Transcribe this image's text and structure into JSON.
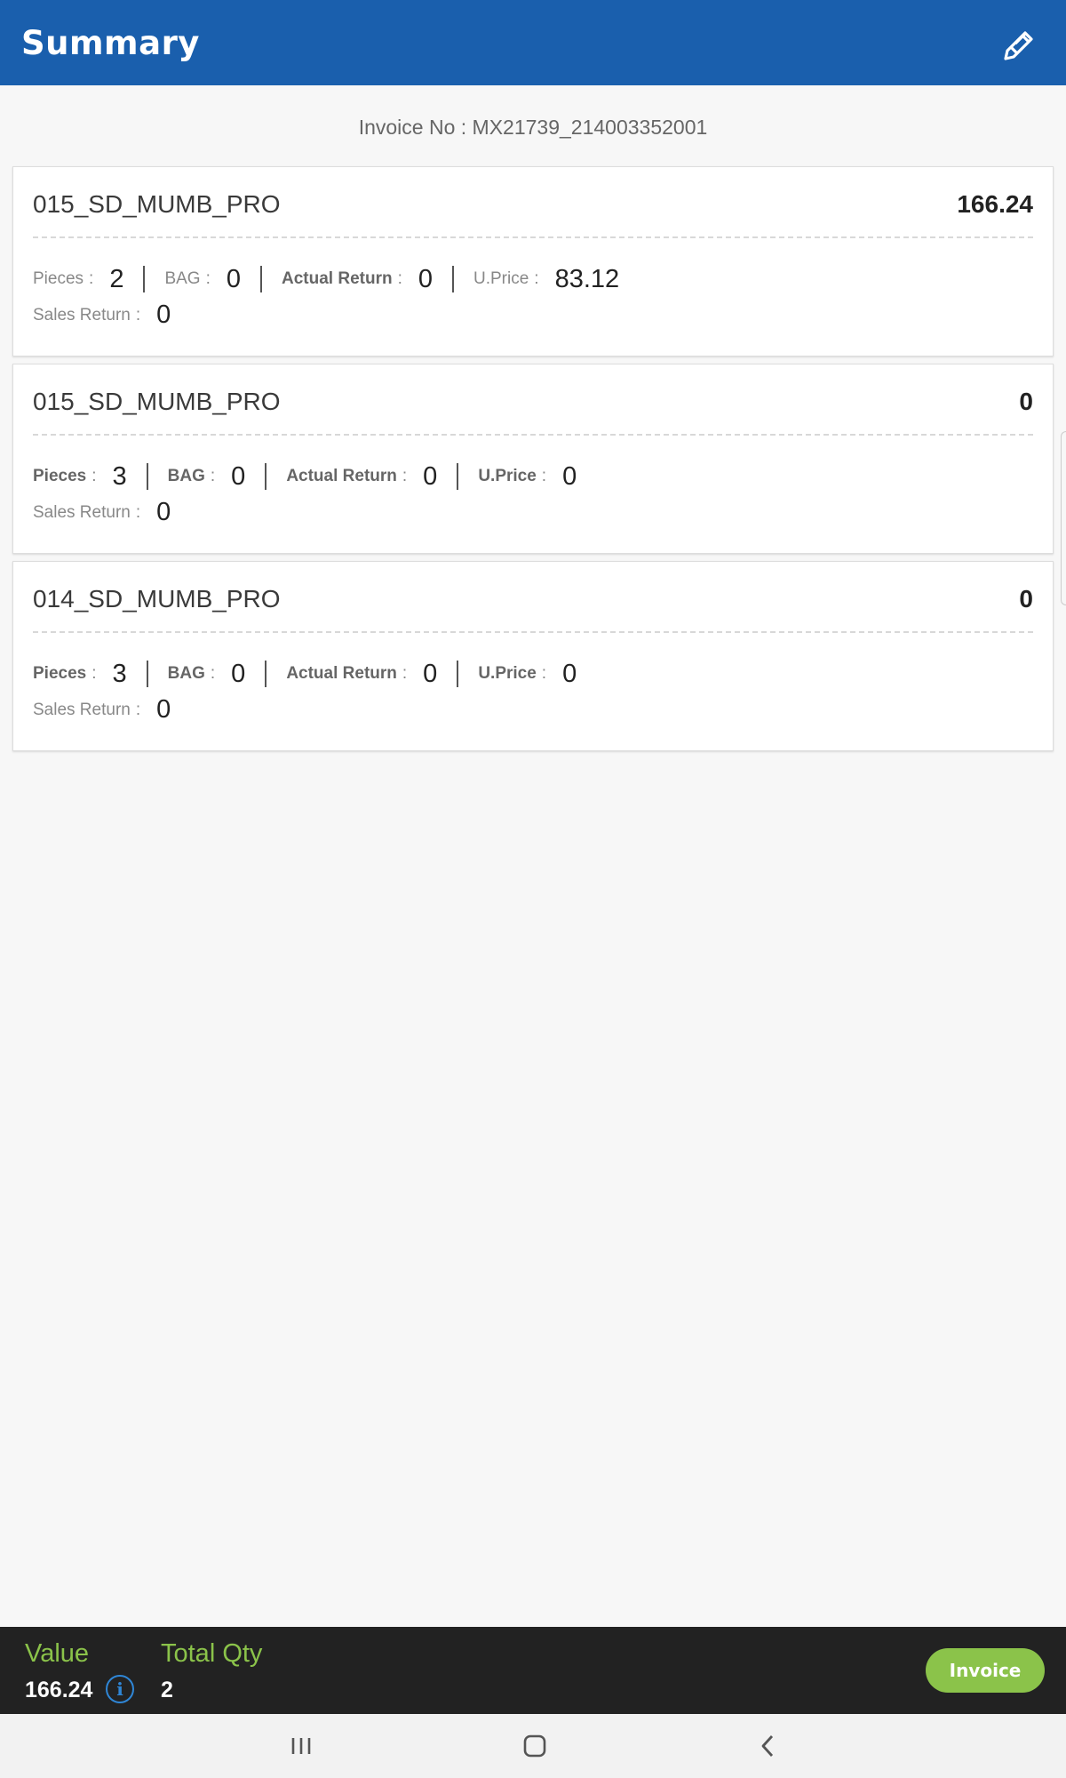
{
  "header": {
    "title": "Summary",
    "edit_icon": "pencil-icon"
  },
  "invoice_no": "Invoice No : MX21739_214003352001",
  "items": [
    {
      "name": "015_SD_MUMB_PRO",
      "value": "166.24",
      "pieces_label": "Pieces",
      "pieces": "2",
      "bag_label": "BAG",
      "bag": "0",
      "actual_return_label": "Actual Return",
      "actual_return": "0",
      "uprice_label": "U.Price",
      "uprice": "83.12",
      "sales_return_label": "Sales Return",
      "sales_return": "0"
    },
    {
      "name": "015_SD_MUMB_PRO",
      "value": "0",
      "pieces_label": "Pieces",
      "pieces": "3",
      "bag_label": "BAG",
      "bag": "0",
      "actual_return_label": "Actual Return",
      "actual_return": "0",
      "uprice_label": "U.Price",
      "uprice": "0",
      "sales_return_label": "Sales Return",
      "sales_return": "0"
    },
    {
      "name": "014_SD_MUMB_PRO",
      "value": "0",
      "pieces_label": "Pieces",
      "pieces": "3",
      "bag_label": "BAG",
      "bag": "0",
      "actual_return_label": "Actual Return",
      "actual_return": "0",
      "uprice_label": "U.Price",
      "uprice": "0",
      "sales_return_label": "Sales Return",
      "sales_return": "0"
    }
  ],
  "footer": {
    "value_label": "Value",
    "value": "166.24",
    "total_qty_label": "Total Qty",
    "total_qty": "2",
    "invoice_button": "Invoice"
  },
  "colors": {
    "primary": "#1a5fad",
    "accent": "#8bc34a",
    "footer_bg": "#222222",
    "info": "#2f86d6"
  },
  "navbar": {
    "recents_icon": "recents-icon",
    "home_icon": "home-icon",
    "back_icon": "back-icon"
  }
}
